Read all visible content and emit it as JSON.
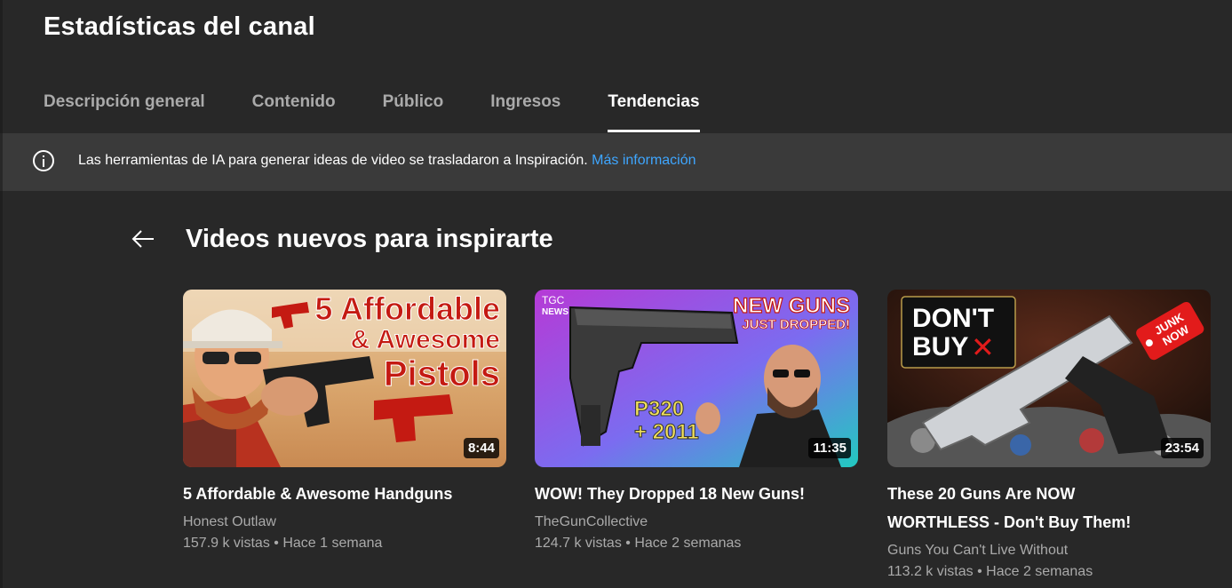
{
  "header": {
    "title": "Estadísticas del canal",
    "tabs": [
      {
        "label": "Descripción general"
      },
      {
        "label": "Contenido"
      },
      {
        "label": "Público"
      },
      {
        "label": "Ingresos"
      },
      {
        "label": "Tendencias"
      }
    ],
    "active_tab": "Tendencias"
  },
  "banner": {
    "icon": "info-icon",
    "text": "Las herramientas de IA para generar ideas de video se trasladaron a Inspiración.",
    "link": "Más información"
  },
  "section": {
    "back_icon": "arrow-left-icon",
    "title": "Videos nuevos para inspirarte"
  },
  "videos": [
    {
      "thumb_text": {
        "line1": "5 Affordable",
        "line2": "& Awesome",
        "line3": "Pistols"
      },
      "duration": "8:44",
      "title": "5 Affordable & Awesome Handguns",
      "channel": "Honest Outlaw",
      "views": "157.9 k vistas",
      "age": "Hace 1 semana"
    },
    {
      "thumb_text": {
        "brand": "TGC",
        "brand2": "NEWS",
        "headline1": "NEW GUNS",
        "headline2": "JUST DROPPED!",
        "model1": "P320",
        "model2": "+ 2011"
      },
      "duration": "11:35",
      "title": "WOW! They Dropped 18 New Guns!",
      "channel": "TheGunCollective",
      "views": "124.7 k vistas",
      "age": "Hace 2 semanas"
    },
    {
      "thumb_text": {
        "line1": "DON'T",
        "line2": "BUY",
        "mark": "✕",
        "tag1": "JUNK",
        "tag2": "NOW"
      },
      "duration": "23:54",
      "title_line1": "These 20 Guns Are NOW",
      "title_line2": "WORTHLESS - Don't Buy Them!",
      "channel": "Guns You Can't Live Without",
      "views": "113.2 k vistas",
      "age": "Hace 2 semanas"
    }
  ],
  "colors": {
    "background": "#282828",
    "banner": "#3a3a3a",
    "link": "#3ea6ff",
    "secondary_text": "#aaaaaa"
  }
}
